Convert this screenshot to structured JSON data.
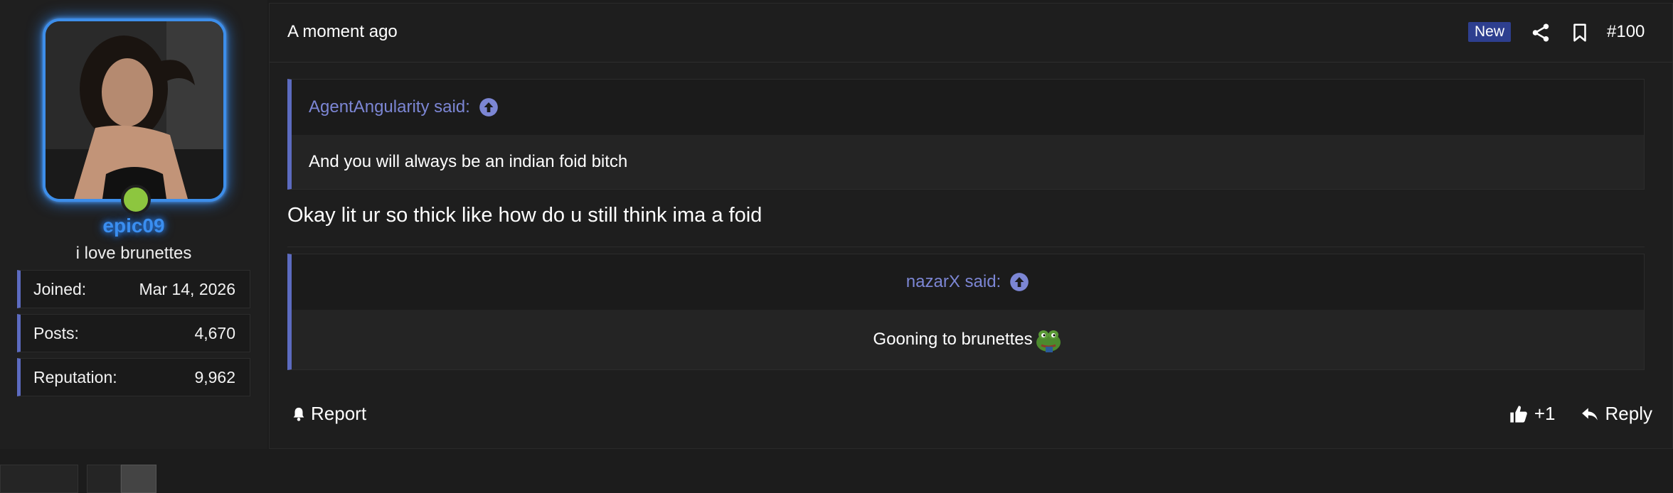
{
  "user": {
    "username": "epic09",
    "title": "i love brunettes",
    "stats": [
      {
        "label": "Joined:",
        "value": "Mar 14, 2026"
      },
      {
        "label": "Posts:",
        "value": "4,670"
      },
      {
        "label": "Reputation:",
        "value": "9,962"
      }
    ],
    "online": true
  },
  "post": {
    "timestamp": "A moment ago",
    "badge": "New",
    "number": "#100",
    "quote1": {
      "author": "AgentAngularity said:",
      "text": "And you will always be an indian foid bitch"
    },
    "message": "Okay lit ur so thick like how do u still think ima a foid",
    "quote2": {
      "author": "nazarX said:",
      "text": "Gooning to brunettes"
    },
    "actions": {
      "report": "Report",
      "like": "+1",
      "reply": "Reply"
    }
  },
  "colors": {
    "accent": "#5c6bc0",
    "username": "#3a8ef0",
    "online": "#8dc63f",
    "badge": "#2e3f8f",
    "quote_author": "#7c86d4"
  },
  "icons": [
    "share-icon",
    "bookmark-icon",
    "arrow-up-circle-icon",
    "bell-icon",
    "thumbs-up-icon",
    "reply-icon",
    "pepe-emoji-icon"
  ]
}
